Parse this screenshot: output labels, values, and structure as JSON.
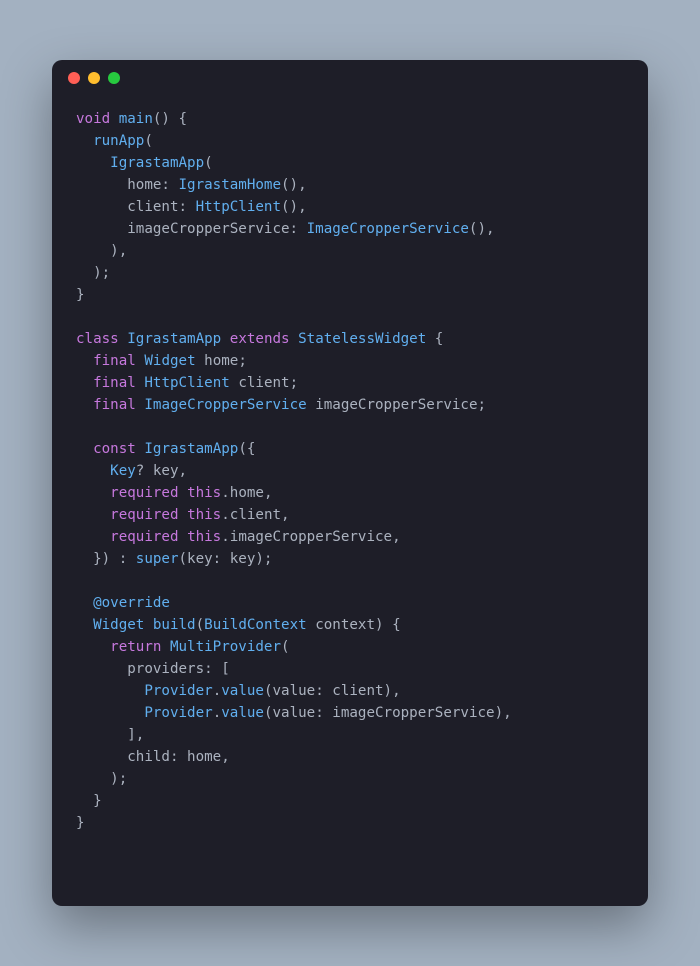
{
  "window": {
    "dots": [
      "red",
      "yellow",
      "green"
    ]
  },
  "code": {
    "tokens": [
      {
        "c": "kw",
        "t": "void"
      },
      {
        "c": "pun",
        "t": " "
      },
      {
        "c": "fn",
        "t": "main"
      },
      {
        "c": "pun",
        "t": "() {\n  "
      },
      {
        "c": "fn",
        "t": "runApp"
      },
      {
        "c": "pun",
        "t": "(\n    "
      },
      {
        "c": "type",
        "t": "IgrastamApp"
      },
      {
        "c": "pun",
        "t": "(\n      home: "
      },
      {
        "c": "type",
        "t": "IgrastamHome"
      },
      {
        "c": "pun",
        "t": "(),\n      client: "
      },
      {
        "c": "type",
        "t": "HttpClient"
      },
      {
        "c": "pun",
        "t": "(),\n      imageCropperService: "
      },
      {
        "c": "type",
        "t": "ImageCropperService"
      },
      {
        "c": "pun",
        "t": "(),\n    ),\n  );\n}\n\n"
      },
      {
        "c": "kw",
        "t": "class"
      },
      {
        "c": "pun",
        "t": " "
      },
      {
        "c": "type",
        "t": "IgrastamApp"
      },
      {
        "c": "pun",
        "t": " "
      },
      {
        "c": "kw",
        "t": "extends"
      },
      {
        "c": "pun",
        "t": " "
      },
      {
        "c": "type",
        "t": "StatelessWidget"
      },
      {
        "c": "pun",
        "t": " {\n  "
      },
      {
        "c": "kw",
        "t": "final"
      },
      {
        "c": "pun",
        "t": " "
      },
      {
        "c": "type",
        "t": "Widget"
      },
      {
        "c": "pun",
        "t": " home;\n  "
      },
      {
        "c": "kw",
        "t": "final"
      },
      {
        "c": "pun",
        "t": " "
      },
      {
        "c": "type",
        "t": "HttpClient"
      },
      {
        "c": "pun",
        "t": " client;\n  "
      },
      {
        "c": "kw",
        "t": "final"
      },
      {
        "c": "pun",
        "t": " "
      },
      {
        "c": "type",
        "t": "ImageCropperService"
      },
      {
        "c": "pun",
        "t": " imageCropperService;\n\n  "
      },
      {
        "c": "kw",
        "t": "const"
      },
      {
        "c": "pun",
        "t": " "
      },
      {
        "c": "type",
        "t": "IgrastamApp"
      },
      {
        "c": "pun",
        "t": "({\n    "
      },
      {
        "c": "type",
        "t": "Key"
      },
      {
        "c": "pun",
        "t": "? key,\n    "
      },
      {
        "c": "req",
        "t": "required"
      },
      {
        "c": "pun",
        "t": " "
      },
      {
        "c": "this",
        "t": "this"
      },
      {
        "c": "pun",
        "t": ".home,\n    "
      },
      {
        "c": "req",
        "t": "required"
      },
      {
        "c": "pun",
        "t": " "
      },
      {
        "c": "this",
        "t": "this"
      },
      {
        "c": "pun",
        "t": ".client,\n    "
      },
      {
        "c": "req",
        "t": "required"
      },
      {
        "c": "pun",
        "t": " "
      },
      {
        "c": "this",
        "t": "this"
      },
      {
        "c": "pun",
        "t": ".imageCropperService,\n  }) : "
      },
      {
        "c": "fn",
        "t": "super"
      },
      {
        "c": "pun",
        "t": "(key: key);\n\n  "
      },
      {
        "c": "ann",
        "t": "@override"
      },
      {
        "c": "pun",
        "t": "\n  "
      },
      {
        "c": "type",
        "t": "Widget"
      },
      {
        "c": "pun",
        "t": " "
      },
      {
        "c": "fn",
        "t": "build"
      },
      {
        "c": "pun",
        "t": "("
      },
      {
        "c": "type",
        "t": "BuildContext"
      },
      {
        "c": "pun",
        "t": " context) {\n    "
      },
      {
        "c": "kw",
        "t": "return"
      },
      {
        "c": "pun",
        "t": " "
      },
      {
        "c": "type",
        "t": "MultiProvider"
      },
      {
        "c": "pun",
        "t": "(\n      providers: [\n        "
      },
      {
        "c": "type",
        "t": "Provider"
      },
      {
        "c": "pun",
        "t": "."
      },
      {
        "c": "fn",
        "t": "value"
      },
      {
        "c": "pun",
        "t": "(value: client),\n        "
      },
      {
        "c": "type",
        "t": "Provider"
      },
      {
        "c": "pun",
        "t": "."
      },
      {
        "c": "fn",
        "t": "value"
      },
      {
        "c": "pun",
        "t": "(value: imageCropperService),\n      ],\n      child: home,\n    );\n  }\n}"
      }
    ]
  }
}
